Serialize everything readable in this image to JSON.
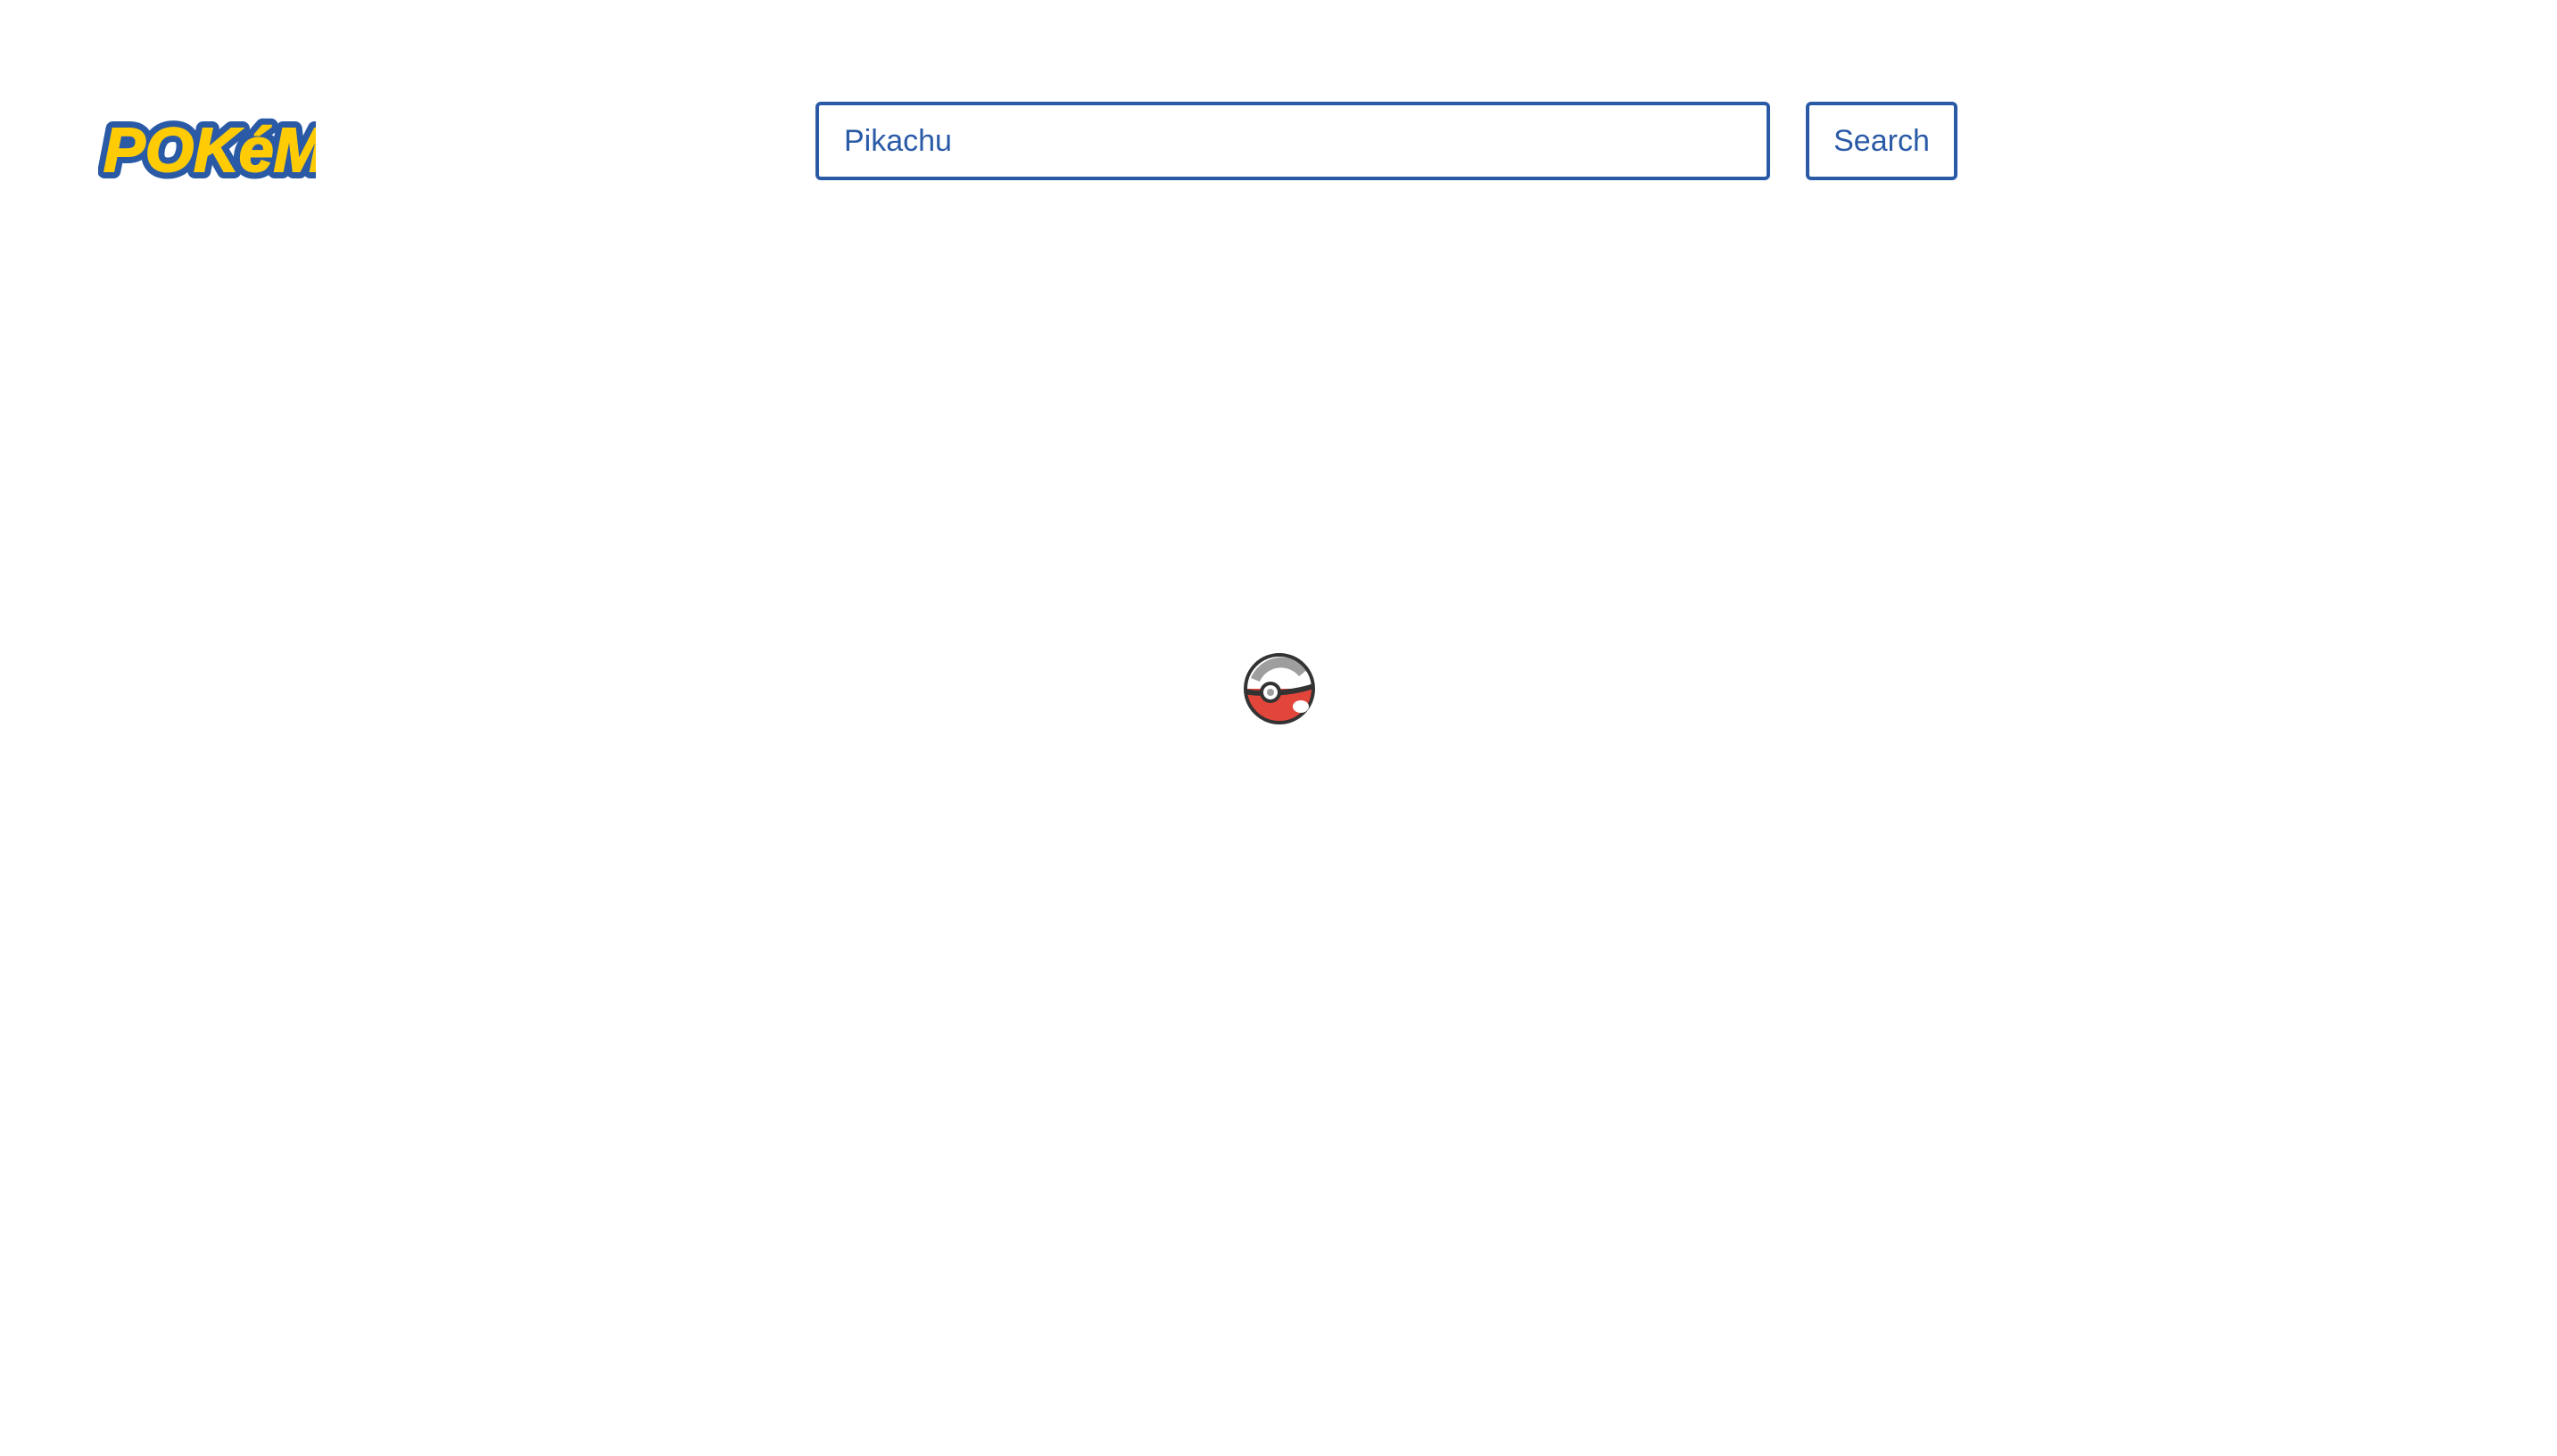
{
  "header": {
    "logo": {
      "text": "POKéMON",
      "icon": "pokemon-logo"
    },
    "search": {
      "value": "Pikachu",
      "button_label": "Search"
    }
  },
  "main": {
    "loader_icon": "pokeball-spinner-icon"
  },
  "colors": {
    "accent": "#2a5aa6",
    "logo_yellow": "#ffcb05",
    "logo_blue": "#2a5aa6",
    "pokeball_red": "#e2453a",
    "pokeball_gray": "#9e9e9e"
  }
}
